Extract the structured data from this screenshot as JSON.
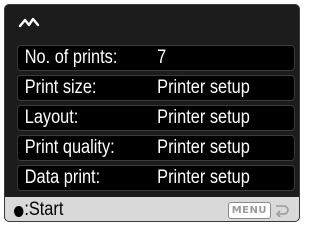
{
  "header": {
    "mode_icon": "playback-mode-icon"
  },
  "menu": {
    "items": [
      {
        "label": "No. of prints:",
        "value": "7"
      },
      {
        "label": "Print size:",
        "value": "Printer setup"
      },
      {
        "label": "Layout:",
        "value": "Printer setup"
      },
      {
        "label": "Print quality:",
        "value": "Printer setup"
      },
      {
        "label": "Data print:",
        "value": "Printer setup"
      }
    ]
  },
  "footer": {
    "start_label": ":Start",
    "menu_label": "MENU",
    "return_icon": "return-arrow-icon"
  },
  "colors": {
    "background": "#1c1c1c",
    "row_background": "#000000",
    "text": "#ffffff",
    "footer_background": "#d9d9d9"
  }
}
